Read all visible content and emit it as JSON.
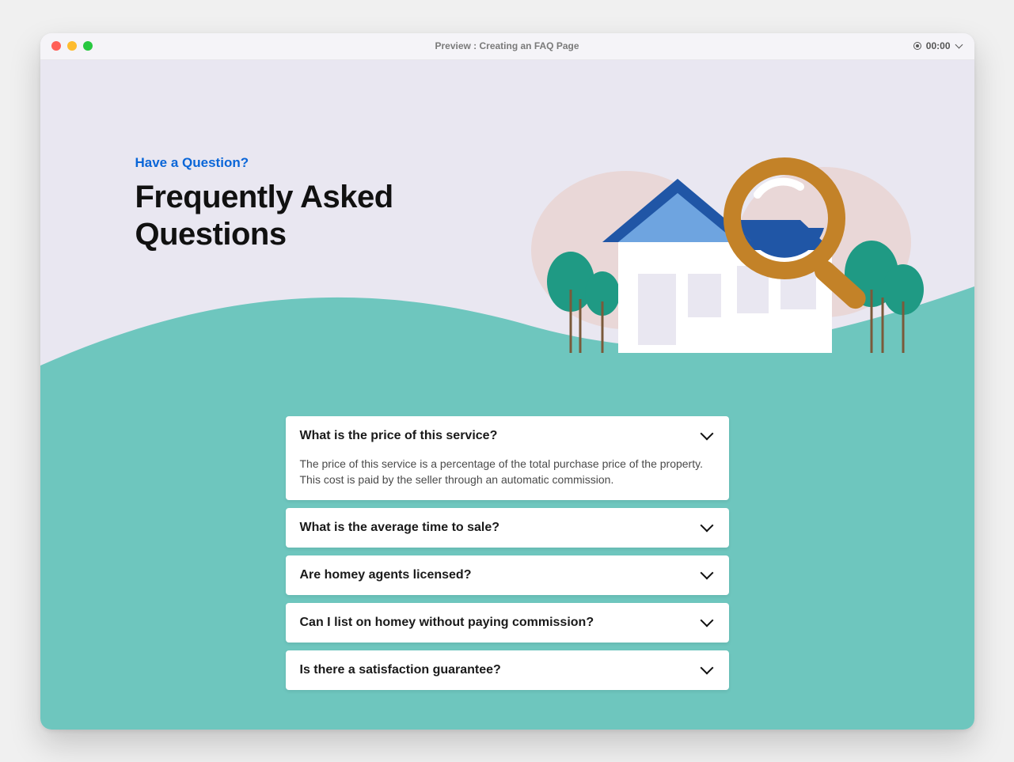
{
  "window": {
    "title": "Preview : Creating an FAQ Page",
    "timer": "00:00"
  },
  "hero": {
    "kicker": "Have a Question?",
    "title": "Frequently Asked Questions"
  },
  "colors": {
    "accent_blue": "#0a66d8",
    "teal": "#6ec6be",
    "lavender": "#e9e7f1",
    "brown": "#c38228",
    "house_blue_light": "#6ea4e0",
    "house_blue_dark": "#2056a6",
    "tree_green": "#1f9a84"
  },
  "faq": [
    {
      "question": "What is the price of this service?",
      "answer": "The price of this service is a percentage of the total purchase price of the property. This cost is paid by the seller through an automatic commission.",
      "expanded": true
    },
    {
      "question": "What is the average time to sale?",
      "expanded": false
    },
    {
      "question": "Are homey agents licensed?",
      "expanded": false
    },
    {
      "question": "Can I list on homey without paying commission?",
      "expanded": false
    },
    {
      "question": "Is there a satisfaction guarantee?",
      "expanded": false
    }
  ]
}
